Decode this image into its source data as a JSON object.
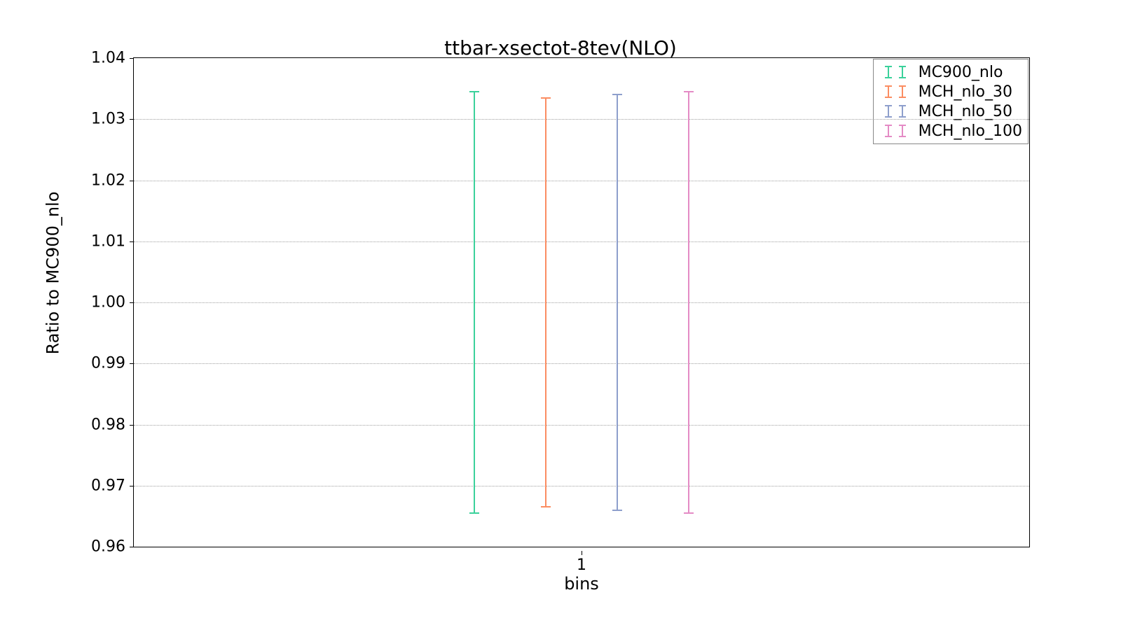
{
  "chart_data": {
    "type": "errorbar",
    "title": "ttbar-xsectot-8tev(NLO)",
    "xlabel": "bins",
    "ylabel": "Ratio to MC900_nlo",
    "xlim": [
      0.5,
      1.5
    ],
    "ylim": [
      0.96,
      1.04
    ],
    "xticks": [
      1
    ],
    "yticks": [
      0.96,
      0.97,
      0.98,
      0.99,
      1.0,
      1.01,
      1.02,
      1.03,
      1.04
    ],
    "categories": [
      1
    ],
    "series": [
      {
        "name": "MC900_nlo",
        "color": "#3bd19b",
        "x": [
          0.88
        ],
        "y": [
          1.0
        ],
        "y_err_low": [
          0.0345
        ],
        "y_err_high": [
          0.0345
        ]
      },
      {
        "name": "MCH_nlo_30",
        "color": "#fb8d62",
        "x": [
          0.96
        ],
        "y": [
          1.0
        ],
        "y_err_low": [
          0.0335
        ],
        "y_err_high": [
          0.0335
        ]
      },
      {
        "name": "MCH_nlo_50",
        "color": "#8e9fcc",
        "x": [
          1.04
        ],
        "y": [
          1.0
        ],
        "y_err_low": [
          0.034
        ],
        "y_err_high": [
          0.034
        ]
      },
      {
        "name": "MCH_nlo_100",
        "color": "#e48bc5",
        "x": [
          1.12
        ],
        "y": [
          1.0
        ],
        "y_err_low": [
          0.0345
        ],
        "y_err_high": [
          0.0345
        ]
      }
    ],
    "ytick_labels": [
      "0.96",
      "0.97",
      "0.98",
      "0.99",
      "1.00",
      "1.01",
      "1.02",
      "1.03",
      "1.04"
    ],
    "xtick_labels": [
      "1"
    ]
  }
}
